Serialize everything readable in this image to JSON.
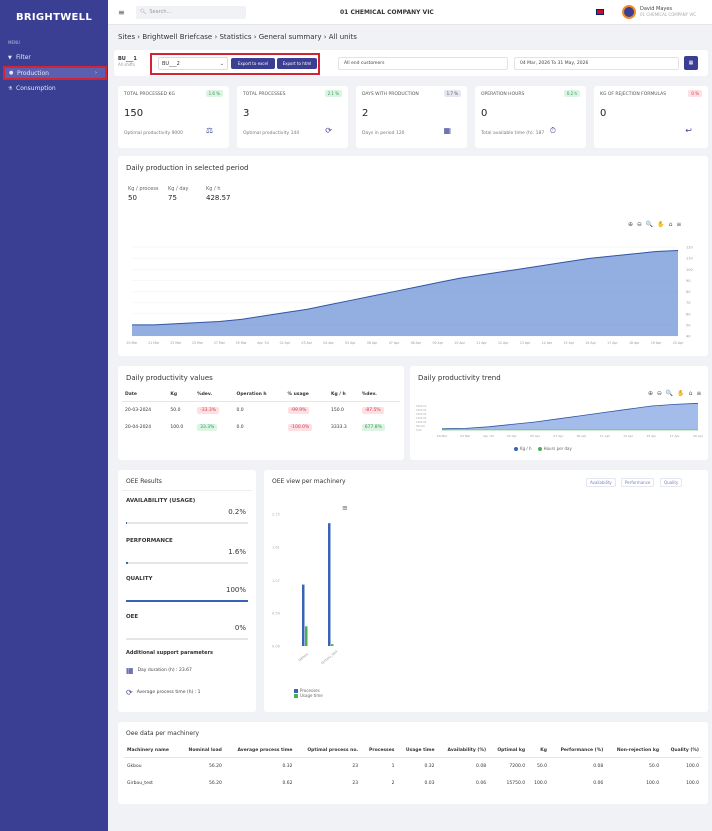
{
  "sidebar": {
    "logo": "BRIGHTWELL",
    "menu_title": "MENU",
    "items": [
      {
        "label": "Filter",
        "icon": "filter-icon"
      },
      {
        "label": "Production",
        "icon": "production-icon",
        "active": true
      },
      {
        "label": "Consumption",
        "icon": "flask-icon"
      }
    ]
  },
  "topbar": {
    "search_placeholder": "Search...",
    "company": "01 CHEMICAL COMPANY VIC",
    "user_name": "David Mayes",
    "user_company": "01 CHEMICAL COMPANY VIC"
  },
  "breadcrumb": "Sites › Brightwell Briefcase › Statistics › General summary › All units",
  "filter": {
    "site_code": "BU___1",
    "site_sub": "All shifts",
    "selected_unit": "BU___2",
    "export_excel": "Export to excel",
    "export_html": "Export to html",
    "customers": "All end customers",
    "date_range": "04 Mar, 2026 To 31 May, 2026"
  },
  "kpis": [
    {
      "label": "TOTAL PROCESSED KG",
      "badge": "1.6 %",
      "badge_color": "green",
      "value": "150",
      "sub": "Optimal productivity 9000",
      "icon": "scale-icon"
    },
    {
      "label": "TOTAL PROCESSES",
      "badge": "2.1 %",
      "badge_color": "green",
      "value": "3",
      "sub": "Optimal productivity 144",
      "icon": "cycle-icon"
    },
    {
      "label": "DAYS WITH PRODUCTION",
      "badge": "1.7 %",
      "badge_color": "grey",
      "value": "2",
      "sub": "Days in period 120",
      "icon": "calendar-icon"
    },
    {
      "label": "OPERATION HOURS",
      "badge": "0.2 h",
      "badge_color": "green",
      "value": "0",
      "sub": "Total available time (h): 187",
      "icon": "timer-icon"
    },
    {
      "label": "KG OF REJECTION FORMULAS",
      "badge": "0 %",
      "badge_color": "red",
      "value": "0",
      "sub": "",
      "icon": "return-icon"
    }
  ],
  "daily_production": {
    "title": "Daily production in selected period",
    "metrics": [
      {
        "label": "Kg / process",
        "value": "50"
      },
      {
        "label": "Kg / day",
        "value": "75"
      },
      {
        "label": "Kg / h",
        "value": "428.57"
      }
    ],
    "toolbar": "⊕ ⊖ 🔍 ✋ ⌂ ≡"
  },
  "productivity_table": {
    "title": "Daily productivity values",
    "headers": [
      "Date",
      "Kg",
      "%dev.",
      "Operation h",
      "% usage",
      "Kg / h",
      "%dev."
    ],
    "rows": [
      {
        "date": "20-03-2024",
        "kg": "50.0",
        "dev1": "-33.3%",
        "op_h": "0.0",
        "usage": "-99.9%",
        "kgh": "150.0",
        "dev2": "-87.5%",
        "dev1_color": "red",
        "usage_color": "red",
        "dev2_color": "red"
      },
      {
        "date": "20-04-2024",
        "kg": "100.0",
        "dev1": "33.3%",
        "op_h": "0.0",
        "usage": "-100.0%",
        "kgh": "3333.3",
        "dev2": "677.8%",
        "dev1_color": "green",
        "usage_color": "red",
        "dev2_color": "green"
      }
    ]
  },
  "trend": {
    "title": "Daily productivity trend",
    "legend": [
      "Kg / h",
      "Hours per day"
    ]
  },
  "oee": {
    "title": "OEE Results",
    "items": [
      {
        "label": "AVAILABILITY (USAGE)",
        "value": "0.2%",
        "fill": 0.002
      },
      {
        "label": "PERFORMANCE",
        "value": "1.6%",
        "fill": 0.016
      },
      {
        "label": "QUALITY",
        "value": "100%",
        "fill": 1.0
      },
      {
        "label": "OEE",
        "value": "0%",
        "fill": 0.0
      }
    ],
    "support_title": "Additional support parameters",
    "day_duration": "Day duration (h) : 23.67",
    "avg_process": "Average process time (h) : 1"
  },
  "oee_machinery": {
    "title": "OEE view per machinery",
    "tabs": [
      "Availability",
      "Performance",
      "Quality"
    ],
    "legend": [
      "Processes",
      "Usage time"
    ]
  },
  "oee_table": {
    "title": "Oee data per machinery",
    "headers": [
      "Machinery name",
      "Nominal load",
      "Average process time",
      "Optimal process no.",
      "Processes",
      "Usage time",
      "Availability (%)",
      "Optimal kg",
      "Kg",
      "Performance (%)",
      "Non-rejection kg",
      "Quality (%)"
    ],
    "rows": [
      [
        "Gkbou",
        "56.20",
        "0.32",
        "23",
        "1",
        "0.32",
        "0.08",
        "7200.0",
        "50.0",
        "0.08",
        "50.0",
        "100.0"
      ],
      [
        "Girbou_test",
        "56.20",
        "0.62",
        "23",
        "2",
        "0.03",
        "0.06",
        "15750.0",
        "100.0",
        "0.06",
        "100.0",
        "100.0"
      ]
    ]
  },
  "chart_data": [
    {
      "type": "area",
      "title": "Daily production in selected period",
      "x": [
        "20 Mar",
        "21 Mar",
        "23 Mar",
        "25 Mar",
        "27 Mar",
        "29 Mar",
        "Apr '24",
        "02 Apr",
        "03 Apr",
        "04 Apr",
        "05 Apr",
        "06 Apr",
        "07 Apr",
        "08 Apr",
        "09 Apr",
        "10 Apr",
        "11 Apr",
        "12 Apr",
        "13 Apr",
        "14 Apr",
        "15 Apr",
        "16 Apr",
        "17 Apr",
        "18 Apr",
        "19 Apr",
        "20 Apr"
      ],
      "values": [
        50,
        50,
        51,
        52,
        53,
        55,
        58,
        61,
        64,
        68,
        72,
        76,
        80,
        84,
        88,
        92,
        95,
        98,
        101,
        104,
        107,
        110,
        112,
        114,
        116,
        117
      ],
      "yticks": [
        40,
        50,
        60,
        70,
        80,
        90,
        100,
        110,
        120
      ],
      "ylim": [
        40,
        130
      ]
    },
    {
      "type": "area",
      "title": "Daily productivity trend",
      "x": [
        "20 Mar",
        "23 Mar",
        "Apr '24",
        "03 Apr",
        "05 Apr",
        "07 Apr",
        "09 Apr",
        "11 Apr",
        "13 Apr",
        "15 Apr",
        "17 Apr",
        "20 Apr"
      ],
      "series": [
        {
          "name": "Kg / h",
          "values": [
            150,
            200,
            400,
            700,
            1000,
            1400,
            1800,
            2200,
            2600,
            3000,
            3200,
            3333.3
          ]
        },
        {
          "name": "Hours per day",
          "values": [
            0,
            0,
            0,
            0,
            0,
            0,
            0,
            0,
            0,
            0,
            0,
            0
          ]
        }
      ],
      "yticks": [
        "3000.00",
        "2500.00",
        "2000.00",
        "1500.00",
        "1000.00",
        "500.00",
        "0.00"
      ],
      "ylim": [
        0,
        3500
      ]
    },
    {
      "type": "bar",
      "title": "OEE view per machinery",
      "categories": [
        "Gkbou",
        "Girbou_test"
      ],
      "series": [
        {
          "name": "Processes",
          "values": [
            1,
            2
          ]
        },
        {
          "name": "Usage time",
          "values": [
            0.32,
            0.03
          ]
        }
      ],
      "yticks": [
        "2.15",
        "1.61",
        "1.07",
        "0.54",
        "0.00"
      ],
      "ylim": [
        0,
        2.15
      ]
    }
  ]
}
